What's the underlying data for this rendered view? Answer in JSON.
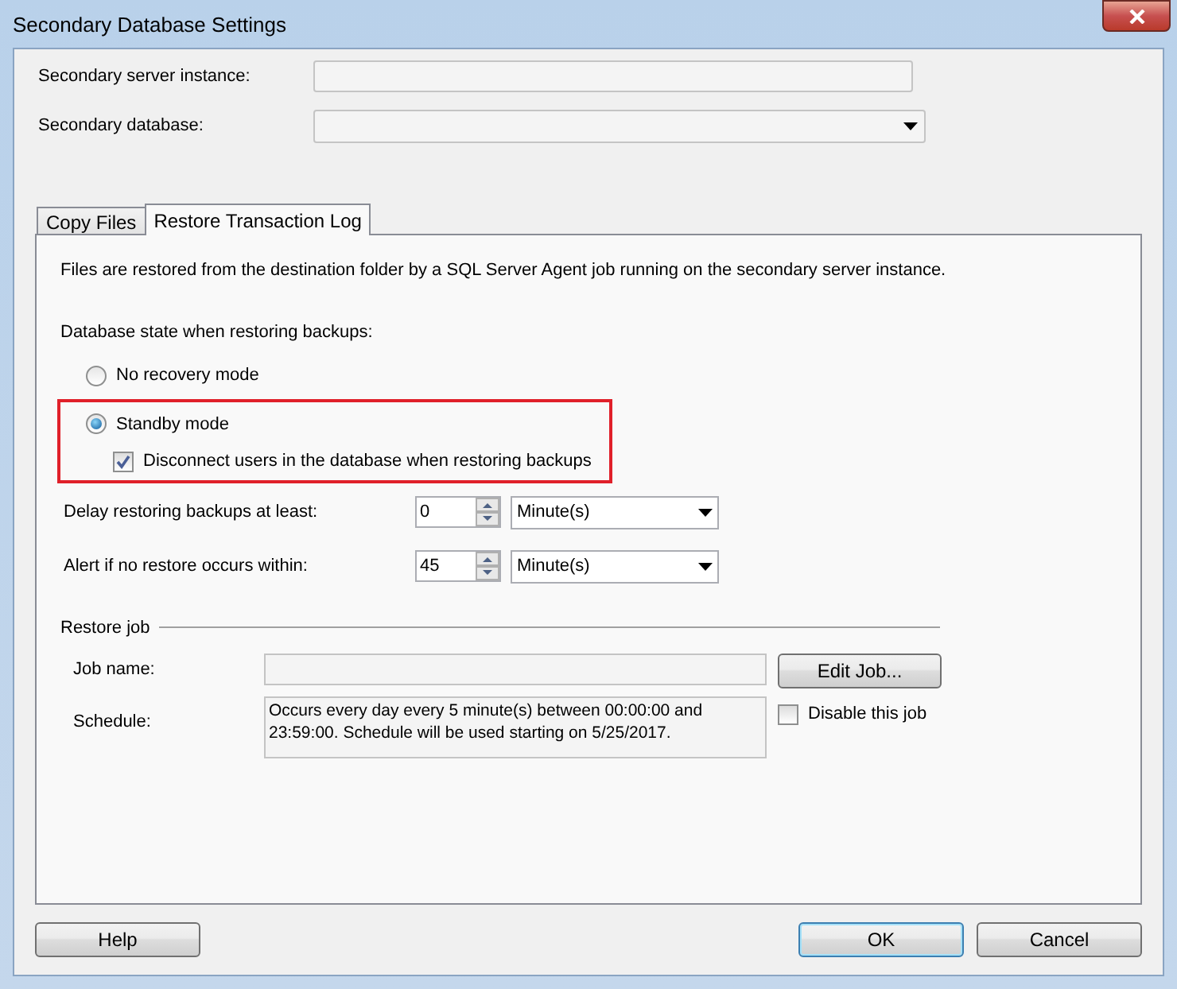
{
  "window": {
    "title": "Secondary Database Settings"
  },
  "fields": [
    {
      "label": "Secondary server instance:",
      "kind": "text"
    },
    {
      "label": "Secondary database:",
      "kind": "combo"
    }
  ],
  "tabs": [
    {
      "label": "Copy Files",
      "selected": false
    },
    {
      "label": "Restore Transaction Log",
      "selected": true
    }
  ],
  "description": "Files are restored from the destination folder by a SQL Server Agent job running on the secondary server instance.",
  "database_state": {
    "label": "Database state when restoring backups:",
    "highlighted": true,
    "options": [
      {
        "label": "No recovery mode",
        "selected": false
      },
      {
        "label": "Standby mode",
        "selected": true
      }
    ],
    "disconnect_users": {
      "label": "Disconnect users in the database when restoring backups",
      "checked": true
    }
  },
  "delays": [
    {
      "label": "Delay restoring backups at least:",
      "value": "0",
      "unit": "Minute(s)"
    },
    {
      "label": "Alert if no restore occurs within:",
      "value": "45",
      "unit": "Minute(s)"
    }
  ],
  "restore_job": {
    "heading": "Restore job",
    "job_name_label": "Job name:",
    "edit_button": "Edit Job...",
    "schedule_label": "Schedule:",
    "schedule": "Occurs every day every 5 minute(s) between 00:00:00 and 23:59:00. Schedule will be used starting on 5/25/2017.",
    "disable": {
      "label": "Disable this job",
      "checked": false
    }
  },
  "buttons": [
    {
      "label": "Help",
      "default": false
    },
    {
      "label": "OK",
      "default": true
    },
    {
      "label": "Cancel",
      "default": false
    }
  ]
}
